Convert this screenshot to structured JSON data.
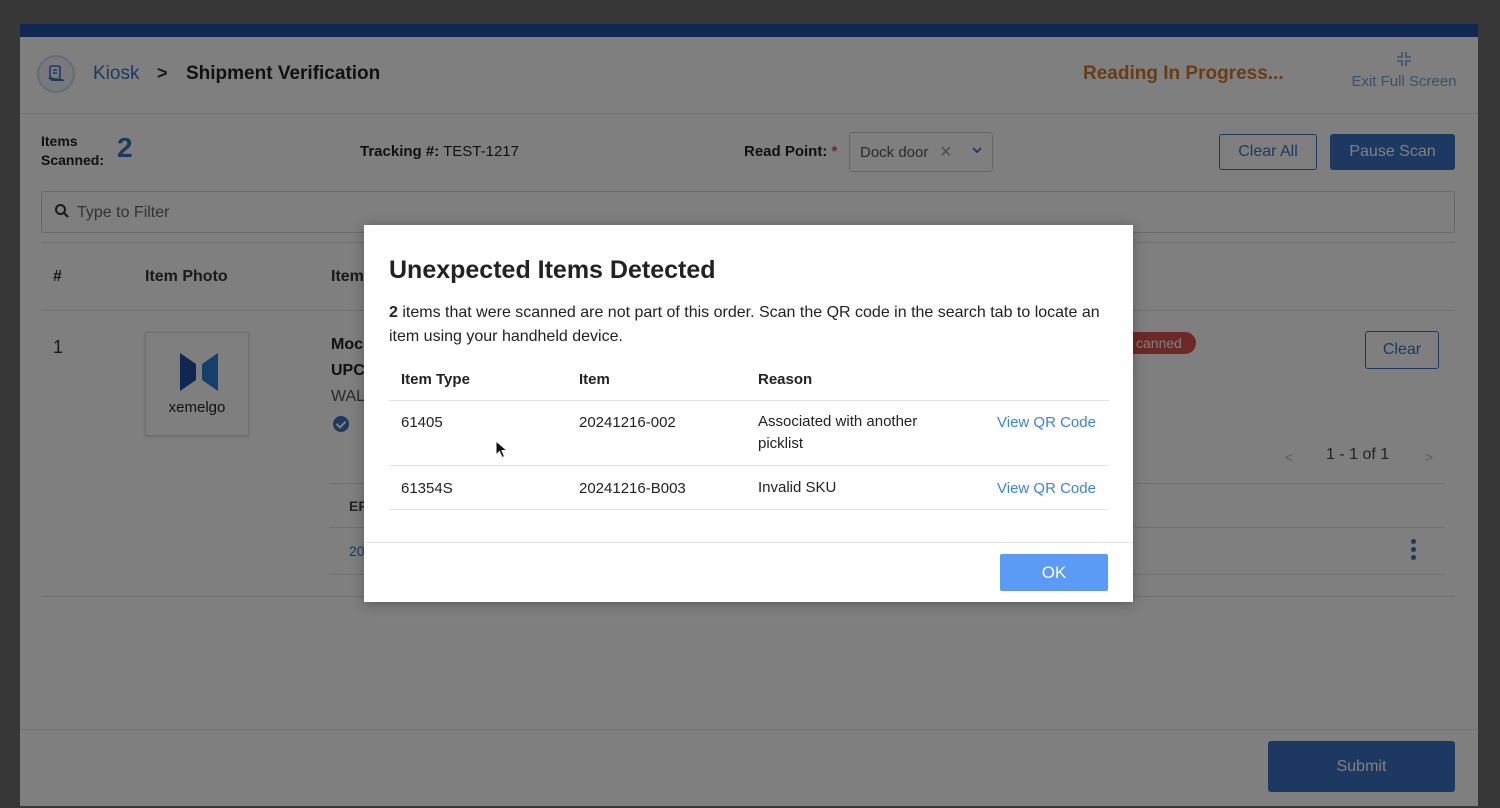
{
  "header": {
    "breadcrumb_root": "Kiosk",
    "breadcrumb_sep": ">",
    "breadcrumb_current": "Shipment Verification",
    "status": "Reading In Progress...",
    "exit_fullscreen": "Exit Full Screen"
  },
  "toolbar": {
    "items_scanned_label": "Items Scanned:",
    "items_scanned_count": "2",
    "tracking_label": "Tracking #:",
    "tracking_value": "TEST-1217",
    "read_point_label": "Read Point:",
    "read_point_required": "*",
    "read_point_value": "Dock door",
    "clear_all": "Clear All",
    "pause_scan": "Pause Scan",
    "filter_placeholder": "Type to Filter"
  },
  "table": {
    "headers": [
      "#",
      "Item Photo",
      "Item"
    ],
    "rows": [
      {
        "number": "1",
        "photo_text": "xemelgo",
        "item_line1": "Moc",
        "item_line2": "UPC",
        "item_line3": "WAL",
        "status": "canned",
        "clear": "Clear",
        "sub_header": "EF",
        "sub_value": "20"
      }
    ],
    "pager": "1 - 1 of 1"
  },
  "footer": {
    "submit": "Submit"
  },
  "modal": {
    "title": "Unexpected Items Detected",
    "desc_count": "2",
    "desc_text": " items that were scanned are not part of this order. Scan the QR code in the search tab to locate an item using your handheld device.",
    "columns": [
      "Item Type",
      "Item",
      "Reason"
    ],
    "rows": [
      {
        "type": "61405",
        "item": "20241216-002",
        "reason": "Associated with another picklist",
        "action": "View QR Code"
      },
      {
        "type": "61354S",
        "item": "20241216-B003",
        "reason": "Invalid SKU",
        "action": "View QR Code"
      }
    ],
    "ok": "OK"
  },
  "colors": {
    "brand": "#1f4fa3",
    "accent": "#3b73c4",
    "status_orange": "#d07a2a",
    "danger": "#d9534f",
    "link": "#3b83e0",
    "ok_button": "#5b9bf5"
  },
  "icons": [
    "kiosk-icon",
    "exit-fullscreen-icon",
    "search-icon",
    "close-icon",
    "chevron-down-icon",
    "xemelgo-logo",
    "check-circle-icon",
    "chevron-left-icon",
    "chevron-right-icon",
    "kebab-icon",
    "cursor-icon"
  ]
}
